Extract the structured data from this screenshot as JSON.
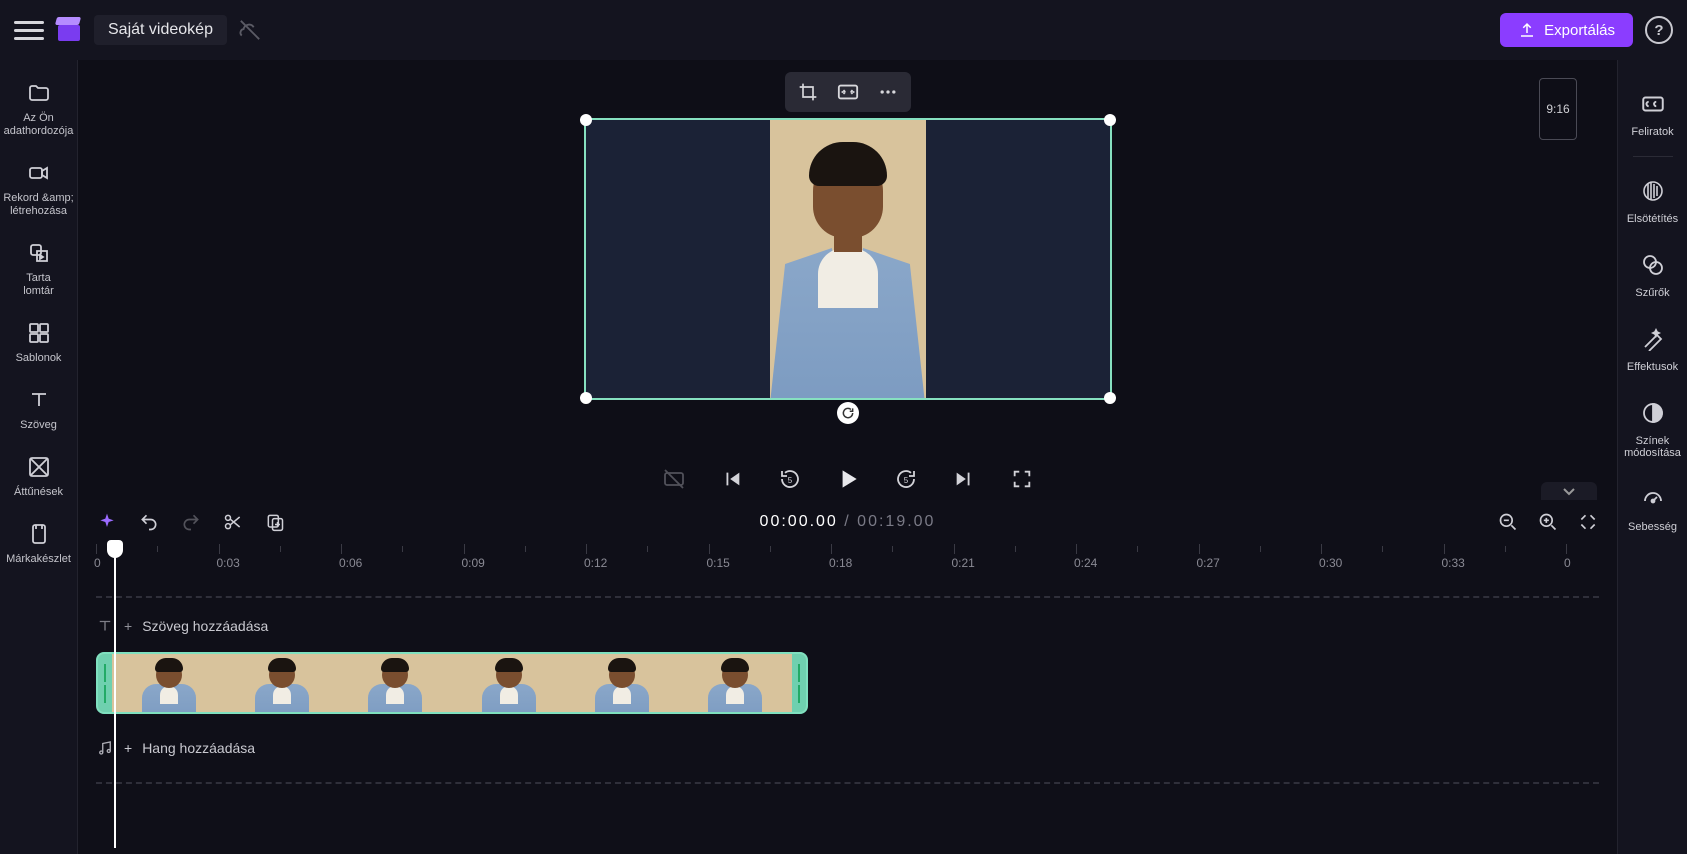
{
  "header": {
    "title": "Saját videokép",
    "export_label": "Exportálás",
    "help_glyph": "?"
  },
  "left_rail": {
    "items": [
      {
        "label": "Az Ön adathordozója"
      },
      {
        "label": "Rekord &amp;\nlétrehozása"
      },
      {
        "label": "Tarta\nlomtár"
      },
      {
        "label": "Sablonok"
      },
      {
        "label": "Szöveg"
      },
      {
        "label": "Áttűnések"
      },
      {
        "label": "Márkakészlet"
      }
    ]
  },
  "right_rail": {
    "items": [
      {
        "label": "Feliratok"
      },
      {
        "label": "Elsötétítés"
      },
      {
        "label": "Szűrők"
      },
      {
        "label": "Effektusok"
      },
      {
        "label": "Színek\nmódosítása"
      },
      {
        "label": "Sebesség"
      }
    ]
  },
  "stage": {
    "aspect_label": "9:16"
  },
  "timeline": {
    "current_time": "00:00.00",
    "separator": " / ",
    "total_time": "00:19.00",
    "ruler_ticks": [
      "0",
      "0:03",
      "0:06",
      "0:09",
      "0:12",
      "0:15",
      "0:18",
      "0:21",
      "0:24",
      "0:27",
      "0:30",
      "0:33",
      "0"
    ],
    "add_text_label": "Szöveg hozzáadása",
    "add_audio_label": "Hang hozzáadása",
    "plus_glyph": "+"
  }
}
